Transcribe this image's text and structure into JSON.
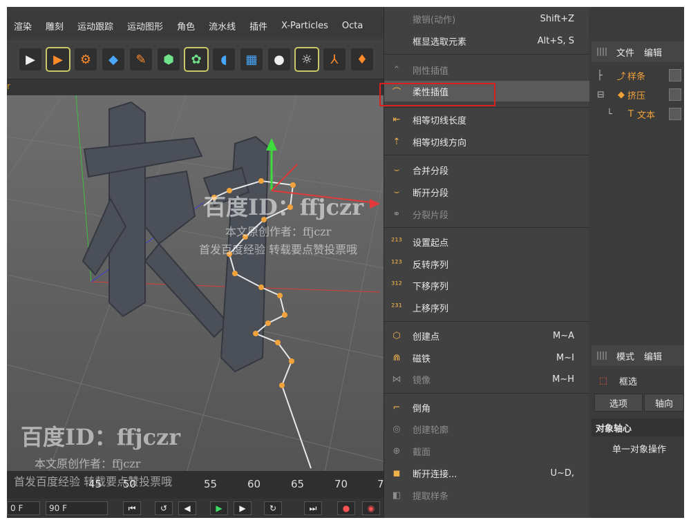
{
  "menubar": [
    "渲染",
    "雕刻",
    "运动跟踪",
    "运动图形",
    "角色",
    "流水线",
    "插件",
    "X-Particles",
    "Octa"
  ],
  "viewport": {
    "label": "r"
  },
  "timeline": {
    "ticks": [
      "45",
      "50",
      "55",
      "60",
      "65",
      "70",
      "7"
    ],
    "frame_start": "0 F",
    "frame_end": "90 F"
  },
  "context_menu": {
    "items": [
      {
        "label": "撤销(动作)",
        "shortcut": "Shift+Z",
        "disabled": true
      },
      {
        "label": "框显选取元素",
        "shortcut": "Alt+S, S",
        "disabled": false
      },
      {
        "label": "刚性插值",
        "shortcut": "",
        "disabled": true
      },
      {
        "label": "柔性插值",
        "shortcut": "",
        "disabled": false,
        "selected": true
      },
      {
        "label": "相等切线长度",
        "shortcut": "",
        "disabled": false
      },
      {
        "label": "相等切线方向",
        "shortcut": "",
        "disabled": false
      },
      {
        "label": "合并分段",
        "shortcut": "",
        "disabled": false
      },
      {
        "label": "断开分段",
        "shortcut": "",
        "disabled": false
      },
      {
        "label": "分裂片段",
        "shortcut": "",
        "disabled": true
      },
      {
        "label": "设置起点",
        "shortcut": "",
        "disabled": false
      },
      {
        "label": "反转序列",
        "shortcut": "",
        "disabled": false
      },
      {
        "label": "下移序列",
        "shortcut": "",
        "disabled": false
      },
      {
        "label": "上移序列",
        "shortcut": "",
        "disabled": false
      },
      {
        "label": "创建点",
        "shortcut": "M~A",
        "disabled": false
      },
      {
        "label": "磁铁",
        "shortcut": "M~I",
        "disabled": false
      },
      {
        "label": "镜像",
        "shortcut": "M~H",
        "disabled": true
      },
      {
        "label": "倒角",
        "shortcut": "",
        "disabled": false
      },
      {
        "label": "创建轮廓",
        "shortcut": "",
        "disabled": true
      },
      {
        "label": "截面",
        "shortcut": "",
        "disabled": true
      },
      {
        "label": "断开连接...",
        "shortcut": "U~D,",
        "disabled": false
      },
      {
        "label": "提取样条",
        "shortcut": "",
        "disabled": true
      }
    ]
  },
  "object_manager": {
    "tabs": [
      "文件",
      "编辑"
    ],
    "objects": [
      {
        "name": "样条",
        "icon": "spline-icon"
      },
      {
        "name": "挤压",
        "icon": "extrude-icon"
      },
      {
        "name": "文本",
        "icon": "text-icon"
      }
    ]
  },
  "attributes": {
    "tabs": [
      "模式",
      "编辑"
    ],
    "tool": "框选",
    "buttons": [
      "选项",
      "轴向"
    ],
    "section": "对象轴心",
    "row": "单一对象操作"
  },
  "watermark": {
    "id": "百度ID：ffjczr",
    "author": "本文原创作者：ffjczr",
    "note": "首发百度经验 转载要点赞投票哦"
  },
  "colors": {
    "accent": "#f2a23a",
    "highlight_border": "#d92020"
  }
}
